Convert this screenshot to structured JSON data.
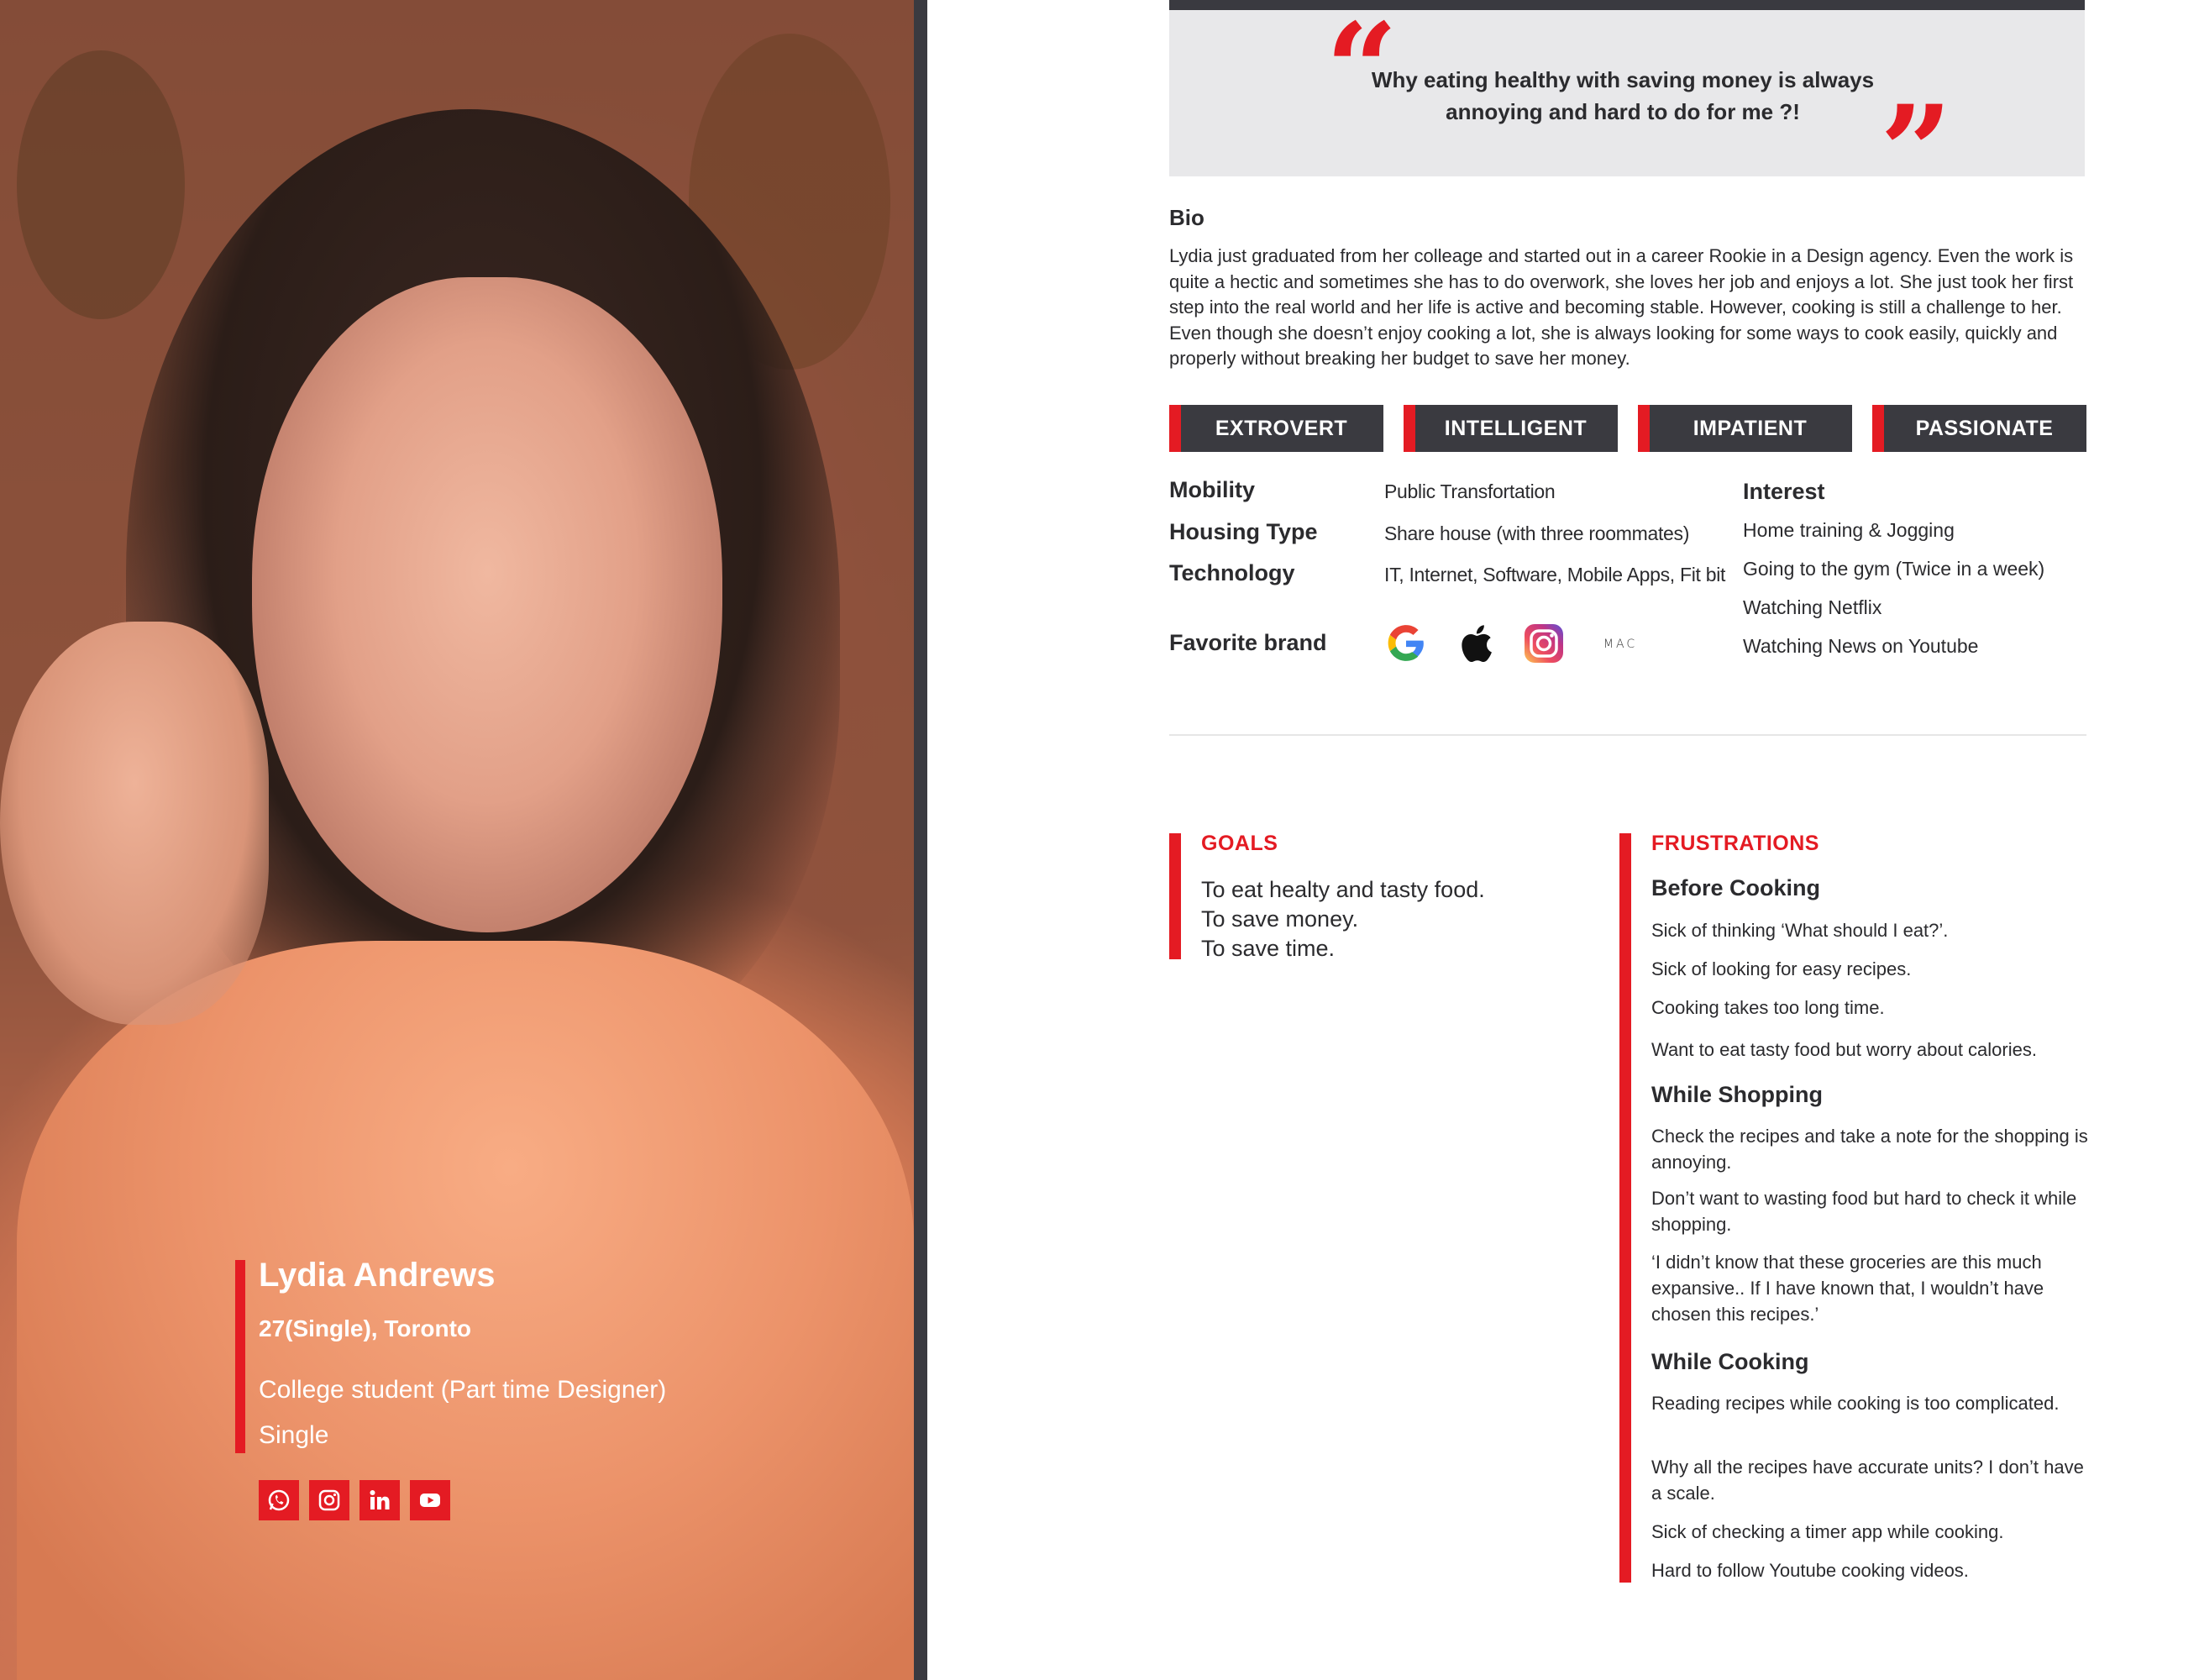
{
  "quote": {
    "open_mark": "“",
    "text": "Why eating healthy with saving money is always annoying and hard to do for me ?!",
    "close_mark": "”"
  },
  "bio": {
    "heading": "Bio",
    "text": "Lydia just graduated from her colleage and started out in a career Rookie in a Design agency. Even the work is quite a hectic and sometimes she has to do overwork, she loves her job and enjoys a lot. She just took her first step into the real world and her life is active and becoming stable. However, cooking is still a challenge to her. Even though she doesn’t enjoy cooking a lot, she is always looking for some ways to cook easily, quickly and properly without breaking her budget to save her money."
  },
  "traits": [
    "EXTROVERT",
    "INTELLIGENT",
    "IMPATIENT",
    "PASSIONATE"
  ],
  "info": {
    "mobility_label": "Mobility",
    "mobility_value": "Public Transfortation",
    "housing_label": "Housing Type",
    "housing_value": "Share house (with three roommates)",
    "technology_label": "Technology",
    "technology_value": "IT, Internet, Software, Mobile Apps, Fit bit",
    "brand_label": "Favorite brand",
    "brands": [
      "google-icon",
      "apple-icon",
      "instagram-icon",
      "mac-cosmetics-logo"
    ],
    "brand_mac_text": "MAC"
  },
  "interest": {
    "heading": "Interest",
    "items": [
      "Home training & Jogging",
      "Going to the gym (Twice in a week)",
      "Watching Netflix",
      "Watching News on Youtube"
    ]
  },
  "goals": {
    "heading": "GOALS",
    "items": [
      "To eat healty and tasty food.",
      "To save money.",
      "To save time."
    ]
  },
  "frustrations": {
    "heading": "FRUSTRATIONS",
    "before_cooking": {
      "title": "Before Cooking",
      "items": [
        "Sick of thinking ‘What should I eat?’.",
        "Sick of looking for easy recipes.",
        "Cooking takes too long time.",
        "Want to eat tasty food but worry about calories."
      ]
    },
    "while_shopping": {
      "title": "While Shopping",
      "items": [
        "Check the recipes and take a note for the shopping is annoying.",
        "Don’t want to wasting food but hard to check it while shopping.",
        "‘I didn’t know that these groceries are this much expansive.. If I have known that, I wouldn’t have chosen this recipes.’"
      ]
    },
    "while_cooking": {
      "title": "While Cooking",
      "items": [
        "Reading recipes while cooking is too complicated.",
        "Why all the recipes have accurate units? I don’t have a scale.",
        "Sick of checking a timer app while cooking.",
        "Hard to follow Youtube cooking videos."
      ]
    }
  },
  "profile": {
    "name": "Lydia Andrews",
    "meta": "27(Single), Toronto",
    "occupation": "College student (Part time Designer)",
    "status": "Single",
    "social": [
      "whatsapp-icon",
      "instagram-icon",
      "linkedin-icon",
      "youtube-icon"
    ]
  },
  "colors": {
    "accent": "#e41b23",
    "dark": "#3a3a40",
    "quote_bg": "#e8e8ea"
  }
}
